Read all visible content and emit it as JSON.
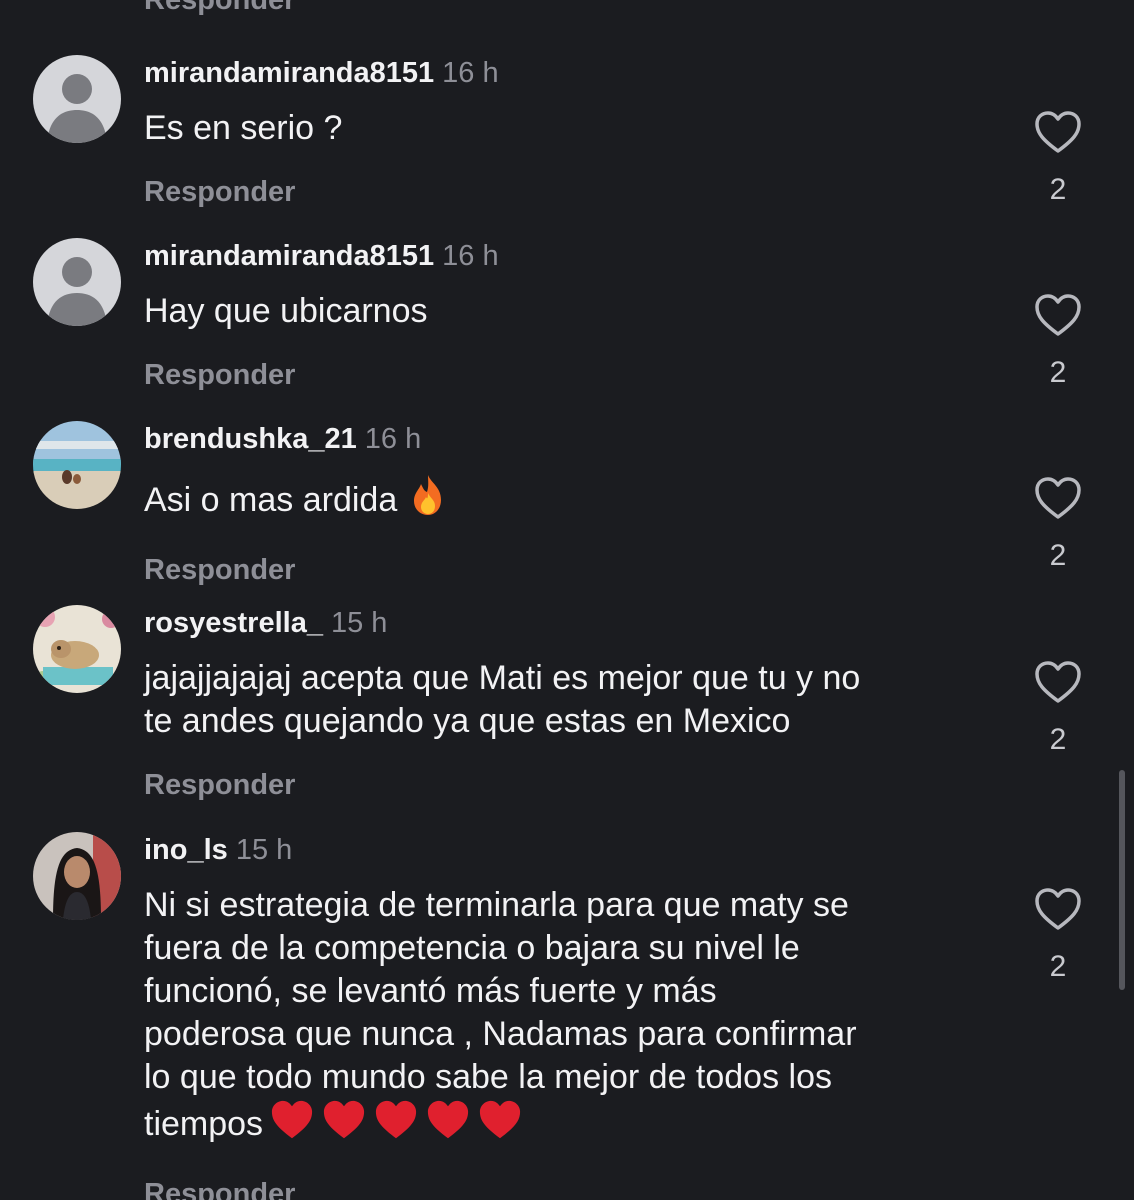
{
  "top_reply_label": "Responder",
  "reply_label": "Responder",
  "comments": [
    {
      "username": "mirandamiranda8151",
      "time": "16 h",
      "text": "Es en serio ?",
      "likes": "2",
      "avatar": "default-avatar"
    },
    {
      "username": "mirandamiranda8151",
      "time": "16 h",
      "text": "Hay que ubicarnos",
      "likes": "2",
      "avatar": "default-avatar"
    },
    {
      "username": "brendushka_21",
      "time": "16 h",
      "text": "Asi o mas ardida",
      "emoji": "fire-emoji",
      "likes": "2",
      "avatar": "beach-photo-avatar"
    },
    {
      "username": "rosyestrella_",
      "time": "15 h",
      "text_lines": [
        "jajajjajajaj acepta que Mati es mejor que tu y no",
        "te andes quejando ya que estas en Mexico"
      ],
      "likes": "2",
      "avatar": "dog-photo-avatar"
    },
    {
      "username": "ino_ls",
      "time": "15 h",
      "text_lines": [
        "Ni si estrategia de terminarla para que maty se",
        "fuera de la competencia o bajara su nivel le",
        "funcionó, se levantó más fuerte y más",
        "poderosa que nunca , Nadamas para confirmar",
        "lo que todo mundo sabe la mejor de todos los",
        "tiempos"
      ],
      "emoji": "red-heart-emoji x5",
      "likes": "2",
      "avatar": "woman-photo-avatar"
    }
  ],
  "colors": {
    "background": "#1b1c20",
    "text": "#f2f2f4",
    "muted": "#8e8f97",
    "heart_emoji": "#e0202e",
    "fire": "#f5821f"
  }
}
